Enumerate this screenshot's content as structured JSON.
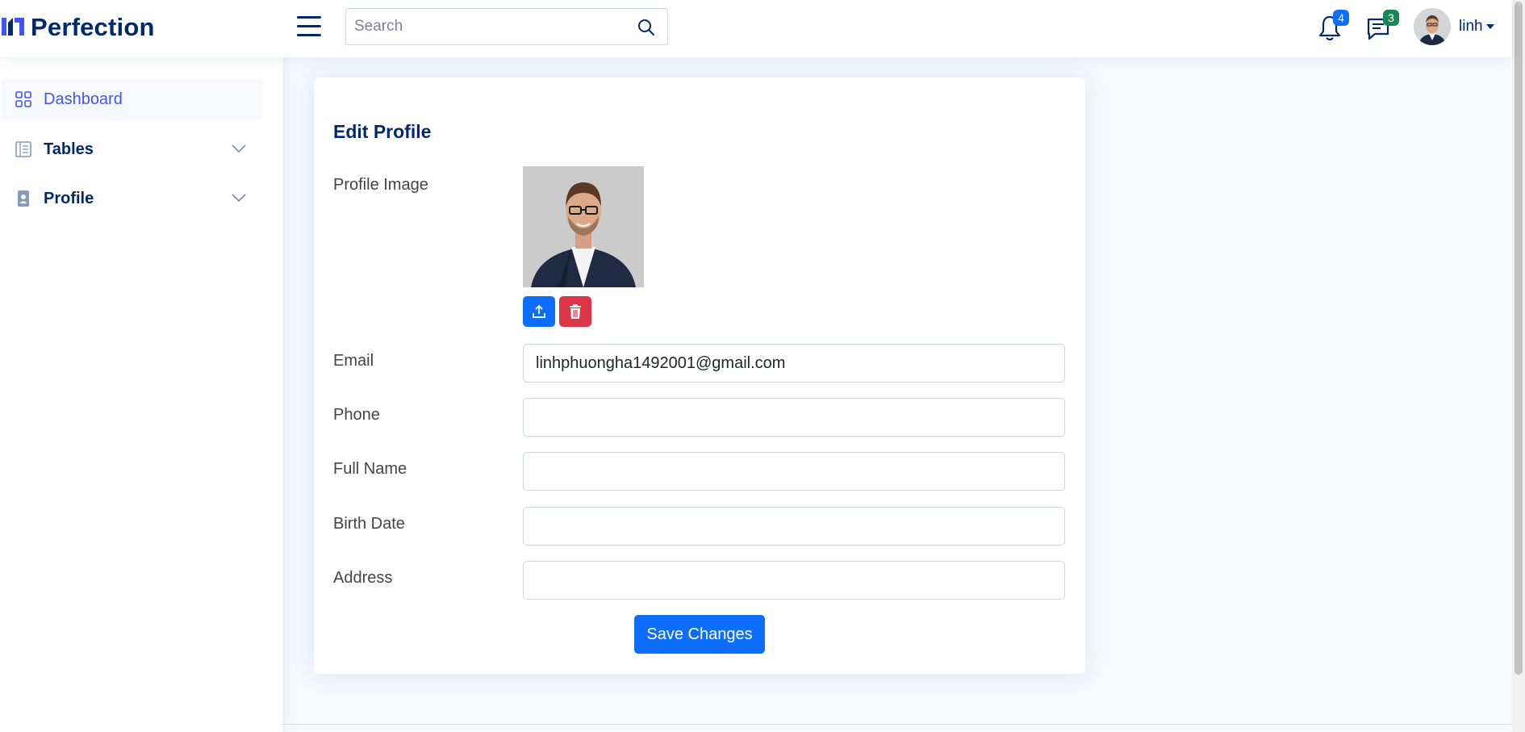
{
  "brand": {
    "name": "Perfection",
    "accent": "#4154f1",
    "dark": "#012970"
  },
  "search": {
    "placeholder": "Search"
  },
  "header": {
    "notifications_count": "4",
    "messages_count": "3",
    "user_name": "linh"
  },
  "sidebar": {
    "items": [
      {
        "label": "Dashboard",
        "icon": "grid-icon",
        "active": true
      },
      {
        "label": "Tables",
        "icon": "table-icon",
        "expandable": true
      },
      {
        "label": "Profile",
        "icon": "person-badge-icon",
        "expandable": true
      }
    ]
  },
  "form": {
    "title": "Edit Profile",
    "profile_image_label": "Profile Image",
    "email_label": "Email",
    "email_value": "linhphuongha1492001@gmail.com",
    "phone_label": "Phone",
    "phone_value": "",
    "fullname_label": "Full Name",
    "fullname_value": "",
    "birthdate_label": "Birth Date",
    "birthdate_value": "",
    "address_label": "Address",
    "address_value": "",
    "save_label": "Save Changes"
  },
  "colors": {
    "primary": "#0d6efd",
    "danger": "#dc3545",
    "success": "#198754"
  }
}
